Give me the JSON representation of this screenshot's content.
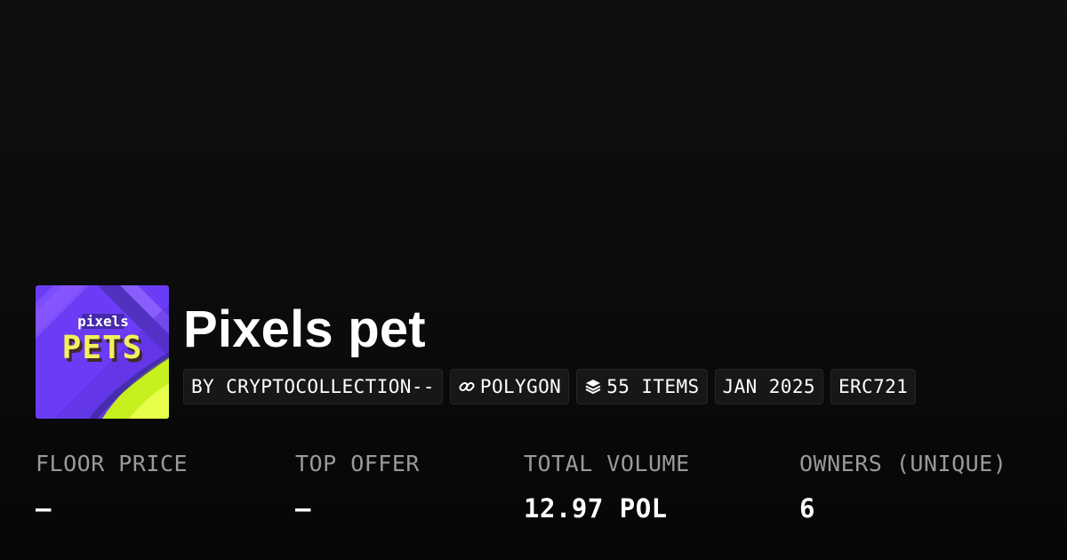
{
  "collection": {
    "name": "Pixels pet",
    "logo": {
      "brand_text": "pixels",
      "product_text": "PETS",
      "colors": {
        "purple": "#6b3cf5",
        "violet": "#8a5cff",
        "lime": "#c6f01e",
        "yellow": "#f4f05a"
      }
    }
  },
  "tags": {
    "creator": "BY CRYPTOCOLLECTION--",
    "chain": "POLYGON",
    "chain_icon": "link-icon",
    "items": "55 ITEMS",
    "items_icon": "layers-icon",
    "created": "JAN 2025",
    "standard": "ERC721"
  },
  "stats": [
    {
      "label": "FLOOR PRICE",
      "value": "–"
    },
    {
      "label": "TOP OFFER",
      "value": "–"
    },
    {
      "label": "TOTAL VOLUME",
      "value": "12.97 POL"
    },
    {
      "label": "OWNERS (UNIQUE)",
      "value": "6"
    }
  ],
  "theme": {
    "background": "#0a0a0a",
    "tag_background": "#171717",
    "label_color": "#9a9a9a",
    "text_color": "#ffffff"
  }
}
